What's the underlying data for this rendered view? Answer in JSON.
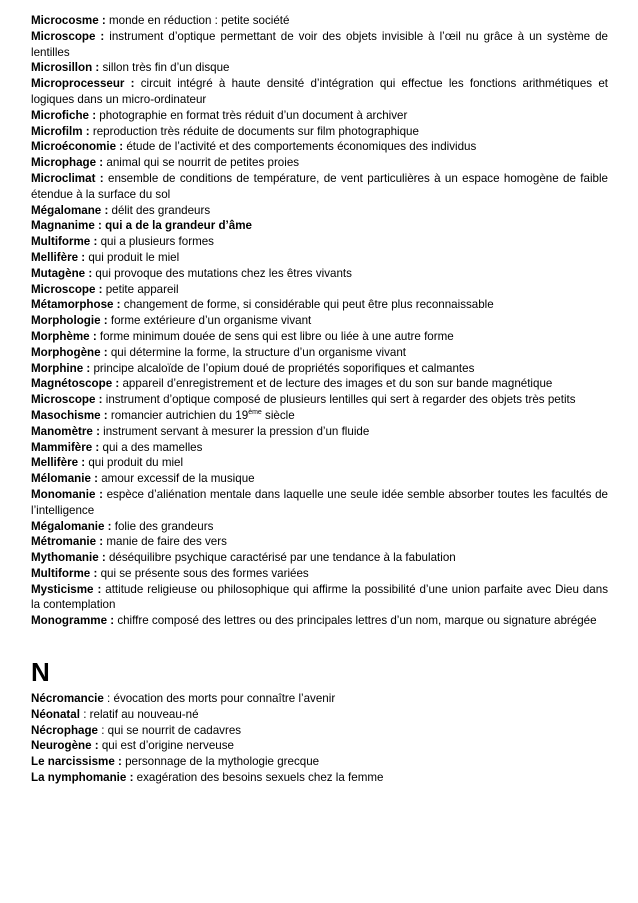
{
  "section_m": {
    "entries": [
      {
        "term": "Microcosme :",
        "def": " monde en réduction : petite société"
      },
      {
        "term": "Microscope :",
        "def": " instrument d’optique permettant de voir des objets invisible à l’œil nu grâce à un système de lentilles"
      },
      {
        "term": "Microsillon :",
        "def": " sillon très fin d’un disque"
      },
      {
        "term": "Microprocesseur :",
        "def": " circuit intégré à haute densité d’intégration qui effectue les fonctions arithmétiques et logiques dans un micro-ordinateur"
      },
      {
        "term": "Microfiche :",
        "def": " photographie en format très réduit d’un document à archiver"
      },
      {
        "term": "Microfilm :",
        "def": " reproduction très réduite de documents sur film photographique"
      },
      {
        "term": "Microéconomie :",
        "def": " étude de l’activité et des comportements économiques des individus"
      },
      {
        "term": "Microphage :",
        "def": " animal qui se nourrit de petites proies"
      },
      {
        "term": "Microclimat :",
        "def": " ensemble de conditions de température, de vent particulières à un espace homogène de faible étendue à la surface du sol"
      },
      {
        "term": "Mégalomane :",
        "def": " délit des grandeurs"
      },
      {
        "term": "Magnanime :",
        "def": " qui a de la grandeur d’âme",
        "bold_def": true
      },
      {
        "term": "Multiforme :",
        "def": " qui a plusieurs formes"
      },
      {
        "term": "Mellifère :",
        "def": " qui produit le miel"
      },
      {
        "term": "Mutagène :",
        "def": " qui provoque des mutations chez les êtres vivants"
      },
      {
        "term": "Microscope :",
        "def": " petite appareil"
      },
      {
        "term": "Métamorphose :",
        "def": " changement de forme, si considérable qui peut être plus reconnaissable"
      },
      {
        "term": "Morphologie :",
        "def": " forme extérieure d’un organisme vivant"
      },
      {
        "term": "Morphème :",
        "def": " forme minimum douée de sens qui est libre ou liée à une autre forme"
      },
      {
        "term": "Morphogène :",
        "def": " qui détermine la forme, la structure d’un organisme vivant"
      },
      {
        "term": "Morphine :",
        "def": " principe alcaloïde de l’opium doué de propriétés soporifiques et calmantes"
      },
      {
        "term": "Magnétoscope :",
        "def": " appareil d’enregistrement et de lecture des images et du son sur bande magnétique"
      },
      {
        "term": "Microscope :",
        "def": " instrument d’optique composé de plusieurs lentilles qui sert à regarder des objets très petits"
      },
      {
        "term": "Masochisme :",
        "def": " romancier autrichien du 19",
        "sup": "ème",
        "def_after": " siècle"
      },
      {
        "term": "Manomètre :",
        "def": " instrument servant à mesurer la pression d’un fluide"
      },
      {
        "term": "Mammifère :",
        "def": " qui a des mamelles"
      },
      {
        "term": "Mellifère :",
        "def": " qui produit du miel"
      },
      {
        "term": "Mélomanie :",
        "def": " amour excessif de la musique"
      },
      {
        "term": "Monomanie :",
        "def": " espèce d’aliénation mentale dans laquelle une seule idée semble absorber toutes les facultés de l’intelligence"
      },
      {
        "term": "Mégalomanie :",
        "def": " folie des grandeurs"
      },
      {
        "term": "Métromanie :",
        "def": " manie de faire des vers"
      },
      {
        "term": "Mythomanie :",
        "def": " déséquilibre psychique caractérisé par une tendance à la fabulation"
      },
      {
        "term": "Multiforme :",
        "def": " qui se présente sous des formes variées"
      },
      {
        "term": "Mysticisme :",
        "def": " attitude religieuse ou philosophique qui affirme la possibilité d’une union parfaite avec Dieu dans la contemplation"
      },
      {
        "term": "Monogramme :",
        "def": " chiffre composé des lettres ou des principales lettres d’un nom, marque ou signature abrégée"
      }
    ]
  },
  "section_n": {
    "letter": "N",
    "entries": [
      {
        "term": "Nécromancie",
        "def": " : évocation des morts pour connaître l’avenir"
      },
      {
        "term": "Néonatal",
        "def": " : relatif au nouveau-né"
      },
      {
        "term": "Nécrophage",
        "def": " : qui se nourrit de cadavres"
      },
      {
        "term": "Neurogène :",
        "def": " qui est d’origine nerveuse"
      },
      {
        "term": "Le narcissisme :",
        "def": " personnage de la mythologie grecque"
      },
      {
        "term": "La nymphomanie :",
        "def": " exagération des besoins sexuels chez la femme"
      }
    ]
  }
}
